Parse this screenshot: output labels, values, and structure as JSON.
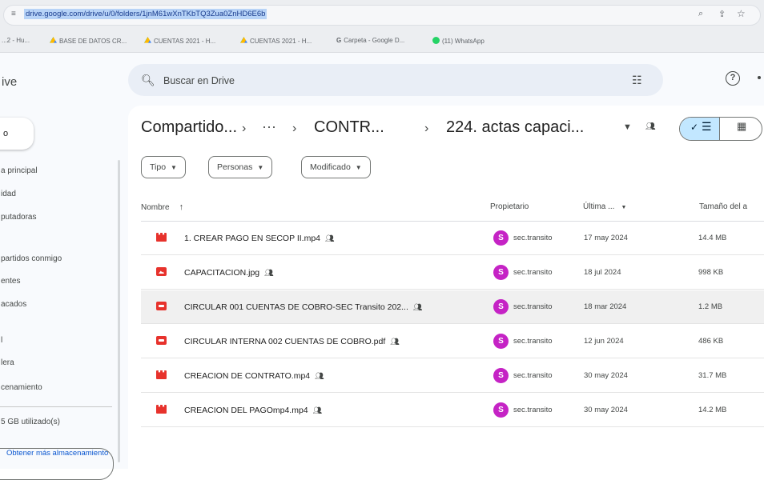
{
  "browser": {
    "url": "drive.google.com/drive/u/0/folders/1jnM61wXnTKbTQ3Zua0ZnHD6E6b",
    "bookmarks": [
      {
        "label": "...2 - Hu...",
        "icon": "none"
      },
      {
        "label": "BASE DE DATOS CR...",
        "icon": "drive-icon"
      },
      {
        "label": "CUENTAS 2021 - H...",
        "icon": "drive-icon"
      },
      {
        "label": "CUENTAS 2021 - H...",
        "icon": "drive-icon"
      },
      {
        "label": "Carpeta - Google D...",
        "icon": "google-icon"
      },
      {
        "label": "(11) WhatsApp",
        "icon": "whatsapp-icon"
      }
    ]
  },
  "drive": {
    "logo_text": "ive",
    "search": {
      "placeholder": "Buscar en Drive"
    },
    "sidebar": {
      "new_label": "o",
      "items": [
        {
          "label": "a principal"
        },
        {
          "label": "idad"
        },
        {
          "label": "putadoras"
        },
        {
          "label": "partidos conmigo"
        },
        {
          "label": "entes"
        },
        {
          "label": "acados"
        },
        {
          "label": "l"
        },
        {
          "label": "lera"
        },
        {
          "label": "cenamiento"
        }
      ],
      "storage_text": "5 GB utilizado(s)",
      "storage_button": "Obtener más almacenamiento"
    },
    "breadcrumb": {
      "root": "Compartido...",
      "more": "···",
      "middle": "CONTR...",
      "current": "224. actas capaci..."
    },
    "filters": [
      {
        "label": "Tipo"
      },
      {
        "label": "Personas"
      },
      {
        "label": "Modificado"
      }
    ],
    "columns": {
      "name": "Nombre",
      "owner": "Propietario",
      "modified": "Última ...",
      "size": "Tamaño del a"
    },
    "files": [
      {
        "name": "1. CREAR PAGO EN SECOP II.mp4",
        "type": "video",
        "owner_initial": "S",
        "owner": "sec.transito",
        "modified": "17 may 2024",
        "size": "14.4 MB",
        "selected": false
      },
      {
        "name": "CAPACITACION.jpg",
        "type": "image",
        "owner_initial": "S",
        "owner": "sec.transito",
        "modified": "18 jul 2024",
        "size": "998 KB",
        "selected": false
      },
      {
        "name": "CIRCULAR 001 CUENTAS DE COBRO-SEC Transito 202...",
        "type": "pdf",
        "owner_initial": "S",
        "owner": "sec.transito",
        "modified": "18 mar 2024",
        "size": "1.2 MB",
        "selected": true
      },
      {
        "name": "CIRCULAR INTERNA 002 CUENTAS DE COBRO.pdf",
        "type": "pdf",
        "owner_initial": "S",
        "owner": "sec.transito",
        "modified": "12 jun 2024",
        "size": "486 KB",
        "selected": false
      },
      {
        "name": "CREACION DE CONTRATO.mp4",
        "type": "video",
        "owner_initial": "S",
        "owner": "sec.transito",
        "modified": "30 may 2024",
        "size": "31.7 MB",
        "selected": false
      },
      {
        "name": "CREACION DEL PAGOmp4.mp4",
        "type": "video",
        "owner_initial": "S",
        "owner": "sec.transito",
        "modified": "30 may 2024",
        "size": "14.2 MB",
        "selected": false
      }
    ]
  }
}
